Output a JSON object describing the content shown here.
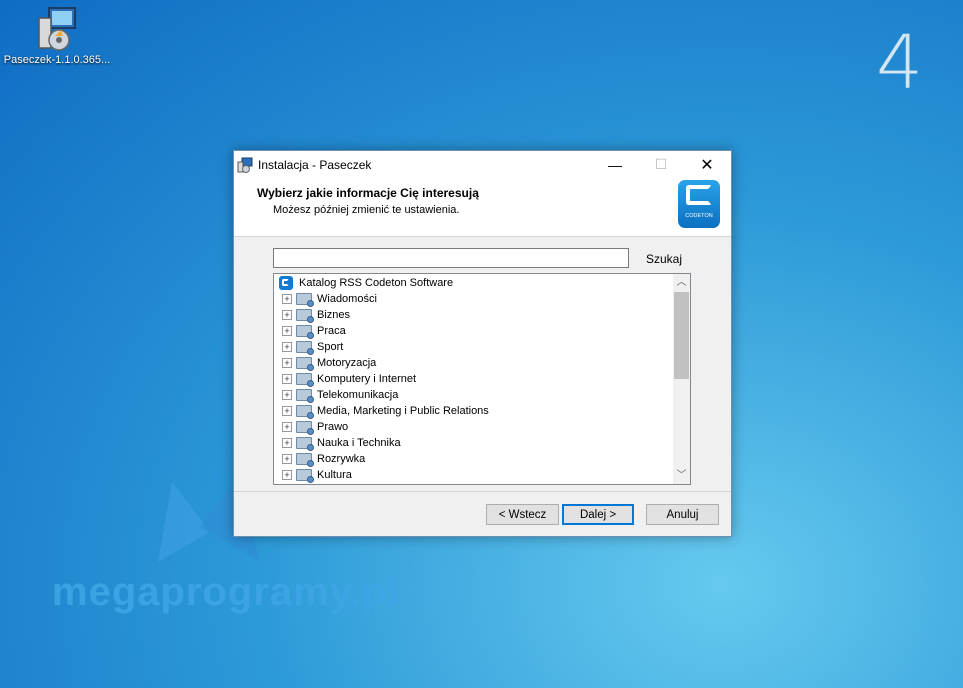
{
  "desktop": {
    "icon_label": "Paseczek-1.1.0.365...",
    "step_number": "4",
    "watermark": "megaprogramy.pl"
  },
  "window": {
    "title": "Instalacja - Paseczek",
    "controls": {
      "minimize": "—",
      "maximize": "☐",
      "close": "✕"
    },
    "header_title": "Wybierz jakie informacje Cię interesują",
    "header_subtitle": "Możesz później zmienić te ustawienia.",
    "brand_text": "CODETON",
    "search": {
      "value": "",
      "button_label": "Szukaj"
    },
    "tree": {
      "root": "Katalog RSS Codeton Software",
      "items": [
        "Wiadomości",
        "Biznes",
        "Praca",
        "Sport",
        "Motoryzacja",
        "Komputery i Internet",
        "Telekomunikacja",
        "Media, Marketing i Public Relations",
        "Prawo",
        "Nauka i Technika",
        "Rozrywka",
        "Kultura"
      ],
      "expander_symbol": "+",
      "scroll_up": "︿",
      "scroll_down": "﹀"
    },
    "buttons": {
      "back": "< Wstecz",
      "next": "Dalej >",
      "cancel": "Anuluj"
    }
  }
}
